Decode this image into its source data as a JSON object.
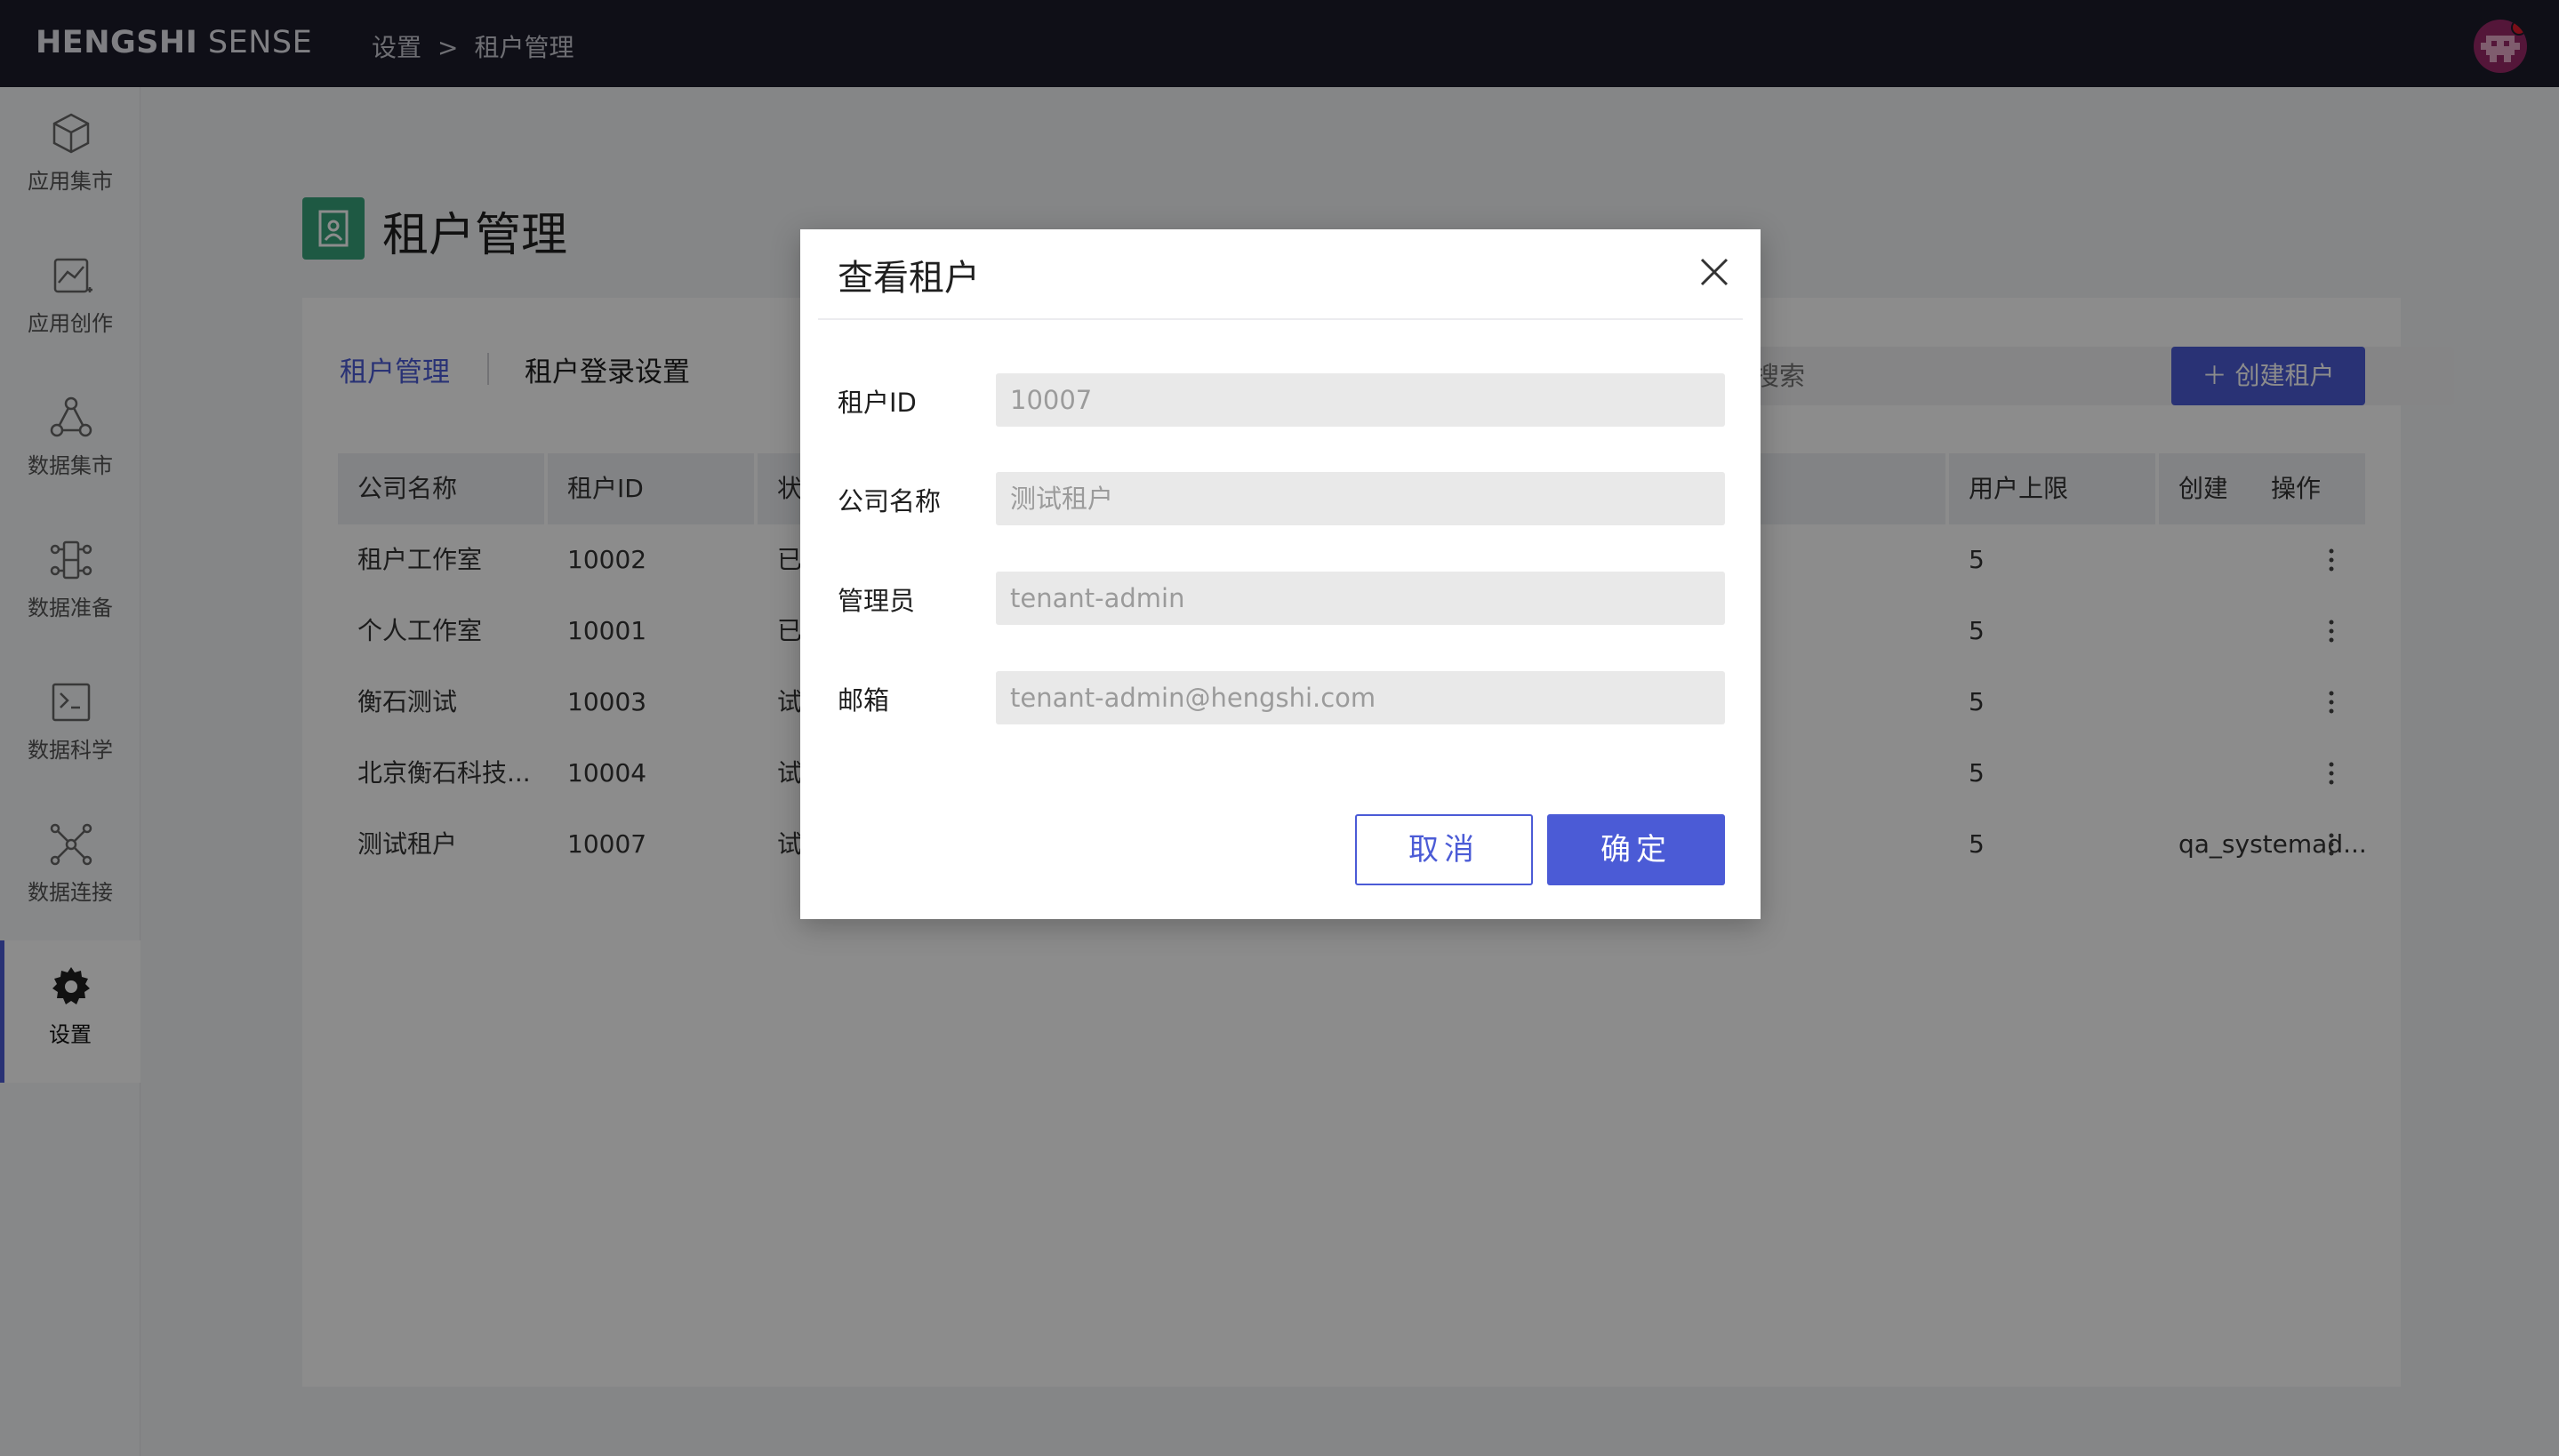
{
  "app": {
    "brand_bold": "HENGSHI",
    "brand_light": " SENSE",
    "breadcrumb": {
      "parent": "设置",
      "separator": ">",
      "current": "租户管理"
    }
  },
  "sidebar": {
    "items": [
      {
        "label": "应用集市",
        "icon": "cube-icon"
      },
      {
        "label": "应用创作",
        "icon": "chart-create-icon"
      },
      {
        "label": "数据集市",
        "icon": "dataset-market-icon"
      },
      {
        "label": "数据准备",
        "icon": "data-prep-icon"
      },
      {
        "label": "数据科学",
        "icon": "terminal-icon"
      },
      {
        "label": "数据连接",
        "icon": "network-icon"
      },
      {
        "label": "设置",
        "icon": "gear-icon",
        "active": true
      }
    ]
  },
  "page": {
    "title": "租户管理",
    "tabs": {
      "active": "租户管理",
      "inactive": "租户登录设置"
    },
    "search_placeholder": "搜索",
    "create_button": "＋ 创建租户"
  },
  "table": {
    "headers": {
      "company": "公司名称",
      "tenant_id": "租户ID",
      "status": "状",
      "user_limit": "用户上限",
      "creator": "创建者",
      "actions": "操作"
    },
    "rows": [
      {
        "company": "租户工作室",
        "tenant_id": "10002",
        "status": "已",
        "user_limit": "5",
        "creator": ""
      },
      {
        "company": "个人工作室",
        "tenant_id": "10001",
        "status": "已",
        "user_limit": "5",
        "creator": ""
      },
      {
        "company": "衡石测试",
        "tenant_id": "10003",
        "status": "试",
        "user_limit": "5",
        "creator": ""
      },
      {
        "company": "北京衡石科技...",
        "tenant_id": "10004",
        "status": "试",
        "user_limit": "5",
        "creator": ""
      },
      {
        "company": "测试租户",
        "tenant_id": "10007",
        "status": "试",
        "user_limit": "5",
        "creator": "qa_systemad..."
      }
    ]
  },
  "modal": {
    "title": "查看租户",
    "fields": [
      {
        "label": "租户ID",
        "value": "10007"
      },
      {
        "label": "公司名称",
        "value": "测试租户"
      },
      {
        "label": "管理员",
        "value": "tenant-admin"
      },
      {
        "label": "邮箱",
        "value": "tenant-admin@hengshi.com"
      }
    ],
    "cancel": "取消",
    "confirm": "确定"
  },
  "colors": {
    "accent": "#4b5bd6",
    "topbar": "#1c1d2b",
    "page_icon": "#37a37a"
  }
}
